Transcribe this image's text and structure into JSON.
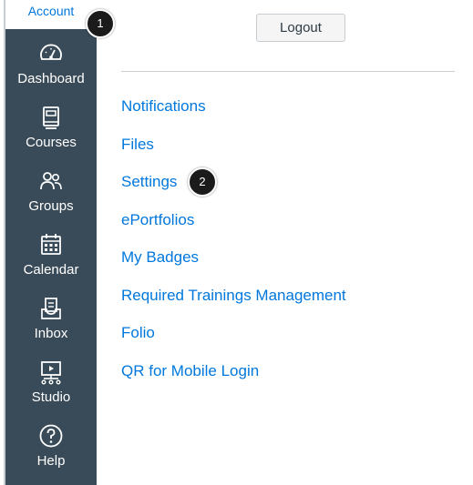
{
  "account_label": "Account",
  "logout_label": "Logout",
  "nav_items": [
    {
      "label": "Dashboard",
      "icon": "dashboard-icon"
    },
    {
      "label": "Courses",
      "icon": "courses-icon"
    },
    {
      "label": "Groups",
      "icon": "groups-icon"
    },
    {
      "label": "Calendar",
      "icon": "calendar-icon"
    },
    {
      "label": "Inbox",
      "icon": "inbox-icon"
    },
    {
      "label": "Studio",
      "icon": "studio-icon"
    },
    {
      "label": "Help",
      "icon": "help-icon"
    }
  ],
  "menu_links": [
    "Notifications",
    "Files",
    "Settings",
    "ePortfolios",
    "My Badges",
    "Required Trainings Management",
    "Folio",
    "QR for Mobile Login"
  ],
  "callouts": [
    "1",
    "2"
  ],
  "colors": {
    "sidebar_bg": "#394b58",
    "link": "#0077dd",
    "callout_bg": "#1b1b1b"
  }
}
